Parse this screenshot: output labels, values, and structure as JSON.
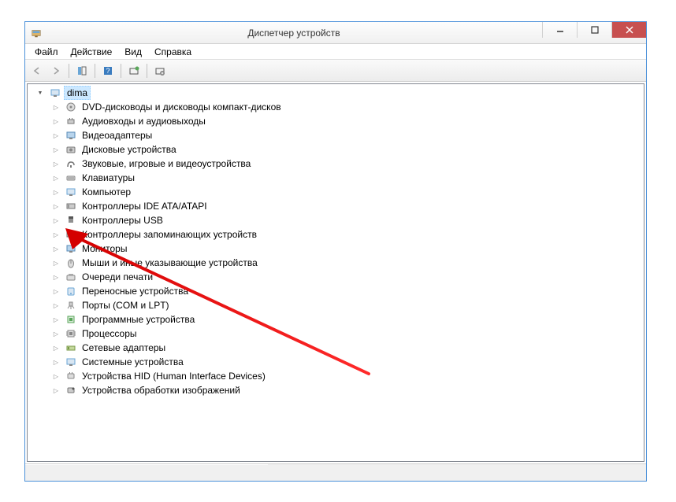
{
  "window": {
    "title": "Диспетчер устройств"
  },
  "menu": {
    "file": "Файл",
    "action": "Действие",
    "view": "Вид",
    "help": "Справка"
  },
  "tree": {
    "root": "dima",
    "items": [
      {
        "label": "DVD-дисководы и дисководы компакт-дисков"
      },
      {
        "label": "Аудиовходы и аудиовыходы"
      },
      {
        "label": "Видеоадаптеры"
      },
      {
        "label": "Дисковые устройства"
      },
      {
        "label": "Звуковые, игровые и видеоустройства"
      },
      {
        "label": "Клавиатуры"
      },
      {
        "label": "Компьютер"
      },
      {
        "label": "Контроллеры IDE ATA/ATAPI"
      },
      {
        "label": "Контроллеры USB"
      },
      {
        "label": "Контроллеры запоминающих устройств"
      },
      {
        "label": "Мониторы"
      },
      {
        "label": "Мыши и иные указывающие устройства"
      },
      {
        "label": "Очереди печати"
      },
      {
        "label": "Переносные устройства"
      },
      {
        "label": "Порты (COM и LPT)"
      },
      {
        "label": "Программные устройства"
      },
      {
        "label": "Процессоры"
      },
      {
        "label": "Сетевые адаптеры"
      },
      {
        "label": "Системные устройства"
      },
      {
        "label": "Устройства HID (Human Interface Devices)"
      },
      {
        "label": "Устройства обработки изображений"
      }
    ]
  }
}
